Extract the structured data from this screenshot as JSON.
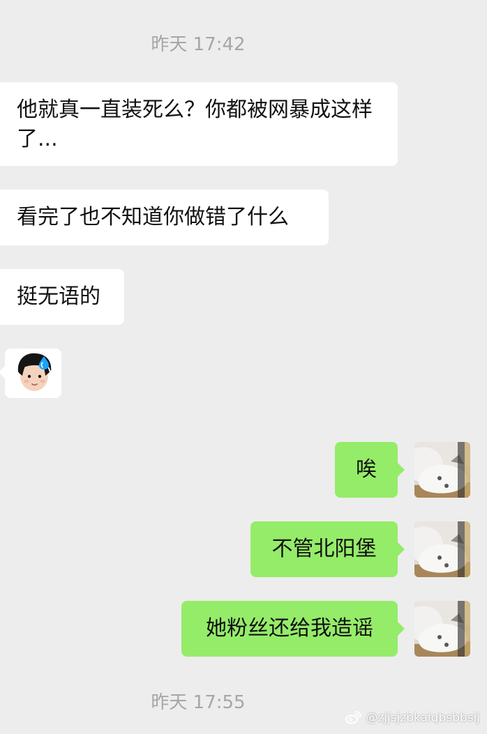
{
  "chat": {
    "timestamps": [
      "昨天 17:42",
      "昨天 17:55"
    ],
    "incoming": [
      "他就真一直装死么？你都被网暴成这样了...",
      "看完了也不知道你做错了什么",
      "挺无语的"
    ],
    "sticker": {
      "icon": "crying-child-sticker-icon"
    },
    "outgoing": [
      "唉",
      "不管北阳堡",
      "她粉丝还给我造谣"
    ]
  },
  "watermark": {
    "text": "@zjjsjzbkaiqbsbbsij",
    "icon": "weibo-logo-icon"
  },
  "colors": {
    "background": "#ededed",
    "incoming_bubble": "#ffffff",
    "outgoing_bubble": "#95ec69",
    "timestamp_text": "#a6a6a6",
    "message_text": "#111111"
  }
}
